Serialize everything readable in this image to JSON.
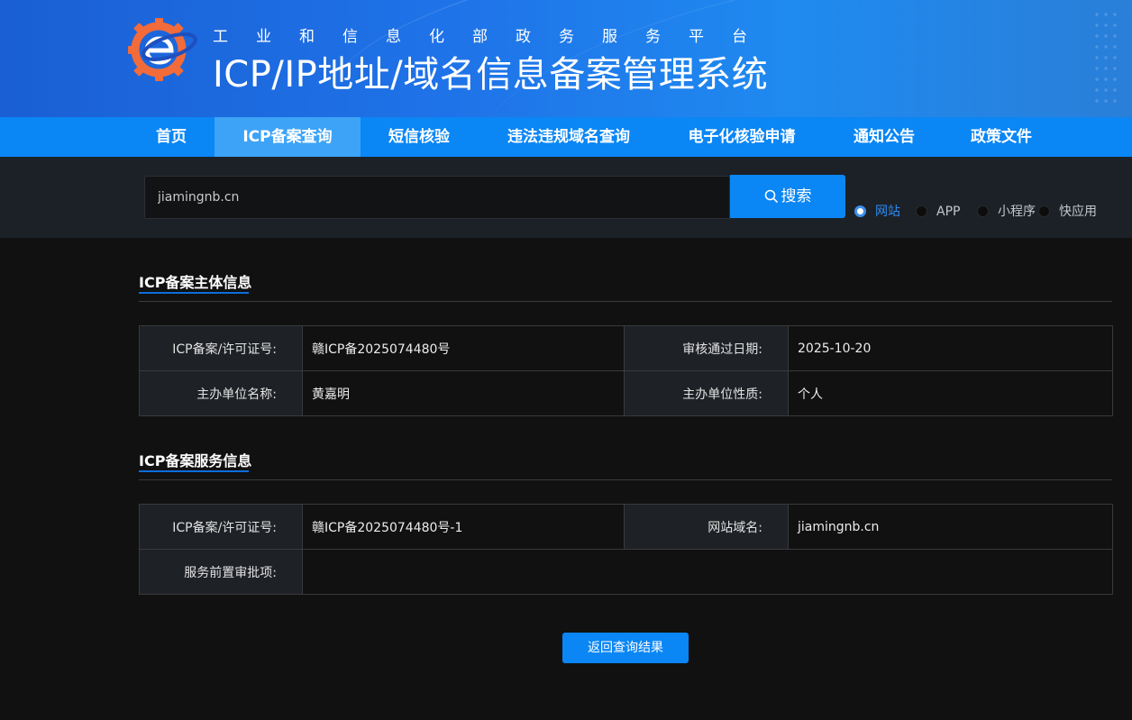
{
  "header": {
    "subtitle": "工业和信息化部政务服务平台",
    "title": "ICP/IP地址/域名信息备案管理系统",
    "logo_icon": "miit-gear-e-logo-icon"
  },
  "nav": {
    "items": [
      {
        "label": "首页",
        "active": false
      },
      {
        "label": "ICP备案查询",
        "active": true
      },
      {
        "label": "短信核验",
        "active": false
      },
      {
        "label": "违法违规域名查询",
        "active": false
      },
      {
        "label": "电子化核验申请",
        "active": false
      },
      {
        "label": "通知公告",
        "active": false
      },
      {
        "label": "政策文件",
        "active": false
      }
    ]
  },
  "search": {
    "value": "jiamingnb.cn",
    "button_label": "搜索",
    "button_icon": "search-icon",
    "types": [
      {
        "label": "网站",
        "checked": true
      },
      {
        "label": "APP",
        "checked": false
      },
      {
        "label": "小程序",
        "checked": false
      },
      {
        "label": "快应用",
        "checked": false
      }
    ]
  },
  "subject": {
    "title": "ICP备案主体信息",
    "rows": [
      {
        "label1": "ICP备案/许可证号:",
        "value1": "赣ICP备2025074480号",
        "label2": "审核通过日期:",
        "value2": "2025-10-20"
      },
      {
        "label1": "主办单位名称:",
        "value1": "黄嘉明",
        "label2": "主办单位性质:",
        "value2": "个人"
      }
    ]
  },
  "service": {
    "title": "ICP备案服务信息",
    "row1": {
      "label1": "ICP备案/许可证号:",
      "value1": "赣ICP备2025074480号-1",
      "label2": "网站域名:",
      "value2": "jiamingnb.cn"
    },
    "row2": {
      "label": "服务前置审批项:",
      "value": ""
    }
  },
  "actions": {
    "back_label": "返回查询结果"
  },
  "colors": {
    "primary": "#0a86f5",
    "nav_active": "#3da3f7",
    "page_bg": "#111112",
    "search_band_bg": "#1c2128",
    "label_cell_bg": "#1e2126"
  }
}
